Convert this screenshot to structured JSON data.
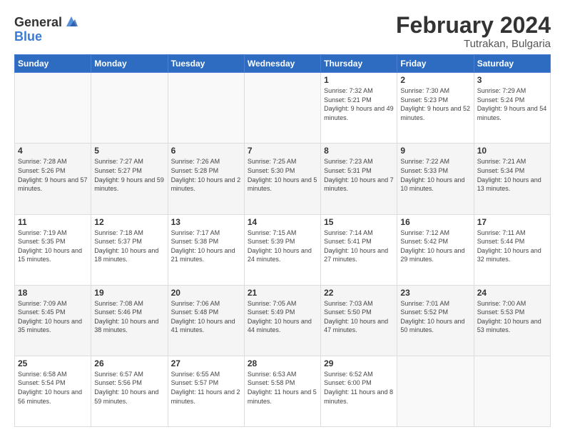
{
  "logo": {
    "general": "General",
    "blue": "Blue"
  },
  "title": "February 2024",
  "subtitle": "Tutrakan, Bulgaria",
  "weekdays": [
    "Sunday",
    "Monday",
    "Tuesday",
    "Wednesday",
    "Thursday",
    "Friday",
    "Saturday"
  ],
  "weeks": [
    [
      {
        "day": "",
        "sunrise": "",
        "sunset": "",
        "daylight": ""
      },
      {
        "day": "",
        "sunrise": "",
        "sunset": "",
        "daylight": ""
      },
      {
        "day": "",
        "sunrise": "",
        "sunset": "",
        "daylight": ""
      },
      {
        "day": "",
        "sunrise": "",
        "sunset": "",
        "daylight": ""
      },
      {
        "day": "1",
        "sunrise": "Sunrise: 7:32 AM",
        "sunset": "Sunset: 5:21 PM",
        "daylight": "Daylight: 9 hours and 49 minutes."
      },
      {
        "day": "2",
        "sunrise": "Sunrise: 7:30 AM",
        "sunset": "Sunset: 5:23 PM",
        "daylight": "Daylight: 9 hours and 52 minutes."
      },
      {
        "day": "3",
        "sunrise": "Sunrise: 7:29 AM",
        "sunset": "Sunset: 5:24 PM",
        "daylight": "Daylight: 9 hours and 54 minutes."
      }
    ],
    [
      {
        "day": "4",
        "sunrise": "Sunrise: 7:28 AM",
        "sunset": "Sunset: 5:26 PM",
        "daylight": "Daylight: 9 hours and 57 minutes."
      },
      {
        "day": "5",
        "sunrise": "Sunrise: 7:27 AM",
        "sunset": "Sunset: 5:27 PM",
        "daylight": "Daylight: 9 hours and 59 minutes."
      },
      {
        "day": "6",
        "sunrise": "Sunrise: 7:26 AM",
        "sunset": "Sunset: 5:28 PM",
        "daylight": "Daylight: 10 hours and 2 minutes."
      },
      {
        "day": "7",
        "sunrise": "Sunrise: 7:25 AM",
        "sunset": "Sunset: 5:30 PM",
        "daylight": "Daylight: 10 hours and 5 minutes."
      },
      {
        "day": "8",
        "sunrise": "Sunrise: 7:23 AM",
        "sunset": "Sunset: 5:31 PM",
        "daylight": "Daylight: 10 hours and 7 minutes."
      },
      {
        "day": "9",
        "sunrise": "Sunrise: 7:22 AM",
        "sunset": "Sunset: 5:33 PM",
        "daylight": "Daylight: 10 hours and 10 minutes."
      },
      {
        "day": "10",
        "sunrise": "Sunrise: 7:21 AM",
        "sunset": "Sunset: 5:34 PM",
        "daylight": "Daylight: 10 hours and 13 minutes."
      }
    ],
    [
      {
        "day": "11",
        "sunrise": "Sunrise: 7:19 AM",
        "sunset": "Sunset: 5:35 PM",
        "daylight": "Daylight: 10 hours and 15 minutes."
      },
      {
        "day": "12",
        "sunrise": "Sunrise: 7:18 AM",
        "sunset": "Sunset: 5:37 PM",
        "daylight": "Daylight: 10 hours and 18 minutes."
      },
      {
        "day": "13",
        "sunrise": "Sunrise: 7:17 AM",
        "sunset": "Sunset: 5:38 PM",
        "daylight": "Daylight: 10 hours and 21 minutes."
      },
      {
        "day": "14",
        "sunrise": "Sunrise: 7:15 AM",
        "sunset": "Sunset: 5:39 PM",
        "daylight": "Daylight: 10 hours and 24 minutes."
      },
      {
        "day": "15",
        "sunrise": "Sunrise: 7:14 AM",
        "sunset": "Sunset: 5:41 PM",
        "daylight": "Daylight: 10 hours and 27 minutes."
      },
      {
        "day": "16",
        "sunrise": "Sunrise: 7:12 AM",
        "sunset": "Sunset: 5:42 PM",
        "daylight": "Daylight: 10 hours and 29 minutes."
      },
      {
        "day": "17",
        "sunrise": "Sunrise: 7:11 AM",
        "sunset": "Sunset: 5:44 PM",
        "daylight": "Daylight: 10 hours and 32 minutes."
      }
    ],
    [
      {
        "day": "18",
        "sunrise": "Sunrise: 7:09 AM",
        "sunset": "Sunset: 5:45 PM",
        "daylight": "Daylight: 10 hours and 35 minutes."
      },
      {
        "day": "19",
        "sunrise": "Sunrise: 7:08 AM",
        "sunset": "Sunset: 5:46 PM",
        "daylight": "Daylight: 10 hours and 38 minutes."
      },
      {
        "day": "20",
        "sunrise": "Sunrise: 7:06 AM",
        "sunset": "Sunset: 5:48 PM",
        "daylight": "Daylight: 10 hours and 41 minutes."
      },
      {
        "day": "21",
        "sunrise": "Sunrise: 7:05 AM",
        "sunset": "Sunset: 5:49 PM",
        "daylight": "Daylight: 10 hours and 44 minutes."
      },
      {
        "day": "22",
        "sunrise": "Sunrise: 7:03 AM",
        "sunset": "Sunset: 5:50 PM",
        "daylight": "Daylight: 10 hours and 47 minutes."
      },
      {
        "day": "23",
        "sunrise": "Sunrise: 7:01 AM",
        "sunset": "Sunset: 5:52 PM",
        "daylight": "Daylight: 10 hours and 50 minutes."
      },
      {
        "day": "24",
        "sunrise": "Sunrise: 7:00 AM",
        "sunset": "Sunset: 5:53 PM",
        "daylight": "Daylight: 10 hours and 53 minutes."
      }
    ],
    [
      {
        "day": "25",
        "sunrise": "Sunrise: 6:58 AM",
        "sunset": "Sunset: 5:54 PM",
        "daylight": "Daylight: 10 hours and 56 minutes."
      },
      {
        "day": "26",
        "sunrise": "Sunrise: 6:57 AM",
        "sunset": "Sunset: 5:56 PM",
        "daylight": "Daylight: 10 hours and 59 minutes."
      },
      {
        "day": "27",
        "sunrise": "Sunrise: 6:55 AM",
        "sunset": "Sunset: 5:57 PM",
        "daylight": "Daylight: 11 hours and 2 minutes."
      },
      {
        "day": "28",
        "sunrise": "Sunrise: 6:53 AM",
        "sunset": "Sunset: 5:58 PM",
        "daylight": "Daylight: 11 hours and 5 minutes."
      },
      {
        "day": "29",
        "sunrise": "Sunrise: 6:52 AM",
        "sunset": "Sunset: 6:00 PM",
        "daylight": "Daylight: 11 hours and 8 minutes."
      },
      {
        "day": "",
        "sunrise": "",
        "sunset": "",
        "daylight": ""
      },
      {
        "day": "",
        "sunrise": "",
        "sunset": "",
        "daylight": ""
      }
    ]
  ]
}
